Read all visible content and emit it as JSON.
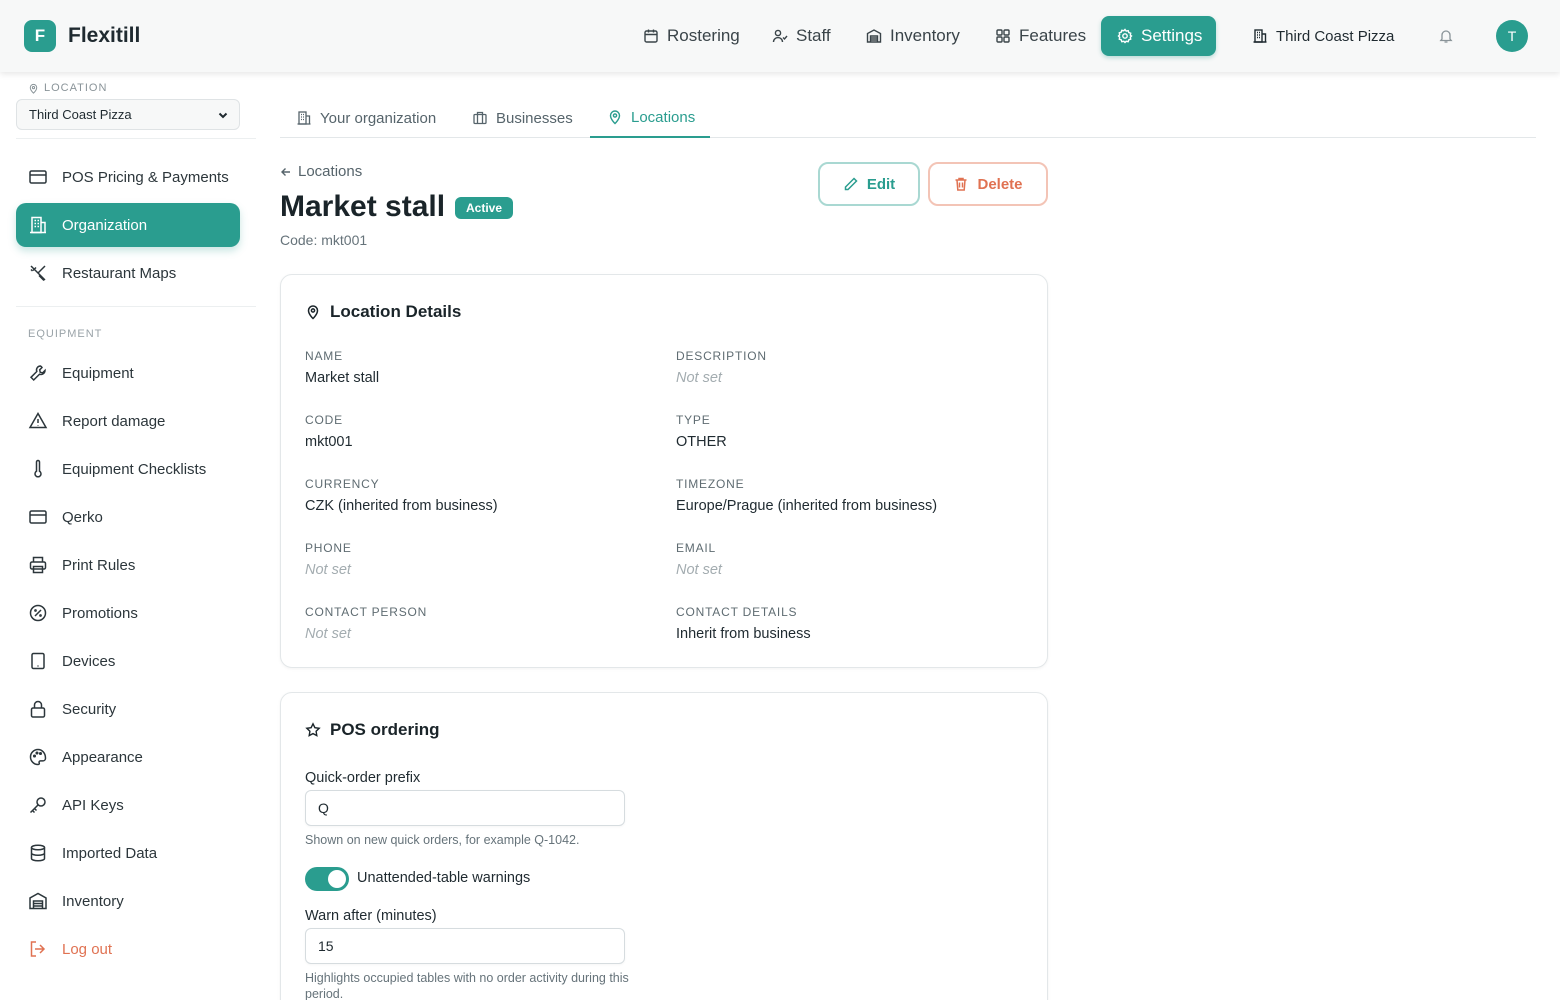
{
  "app": {
    "logo_letter": "F",
    "name": "Flexitill"
  },
  "topnav": {
    "items": [
      {
        "label": "Rostering",
        "icon": "calendar-icon"
      },
      {
        "label": "Staff",
        "icon": "user-icon"
      },
      {
        "label": "Inventory",
        "icon": "warehouse-icon"
      },
      {
        "label": "Features",
        "icon": "grid-icon"
      },
      {
        "label": "Settings",
        "icon": "gear-icon",
        "active": true
      }
    ],
    "org": "Third Coast Pizza",
    "avatar_letter": "T"
  },
  "sidebar": {
    "location_label": "LOCATION",
    "location_value": "Third Coast Pizza",
    "items": [
      {
        "label": "POS Pricing & Payments",
        "icon": "credit-card-icon"
      },
      {
        "label": "Organization",
        "icon": "building-icon",
        "active": true
      },
      {
        "label": "Restaurant Maps",
        "icon": "utensils-icon"
      }
    ],
    "equipment_section": "EQUIPMENT",
    "equipment_items": [
      {
        "label": "Equipment",
        "icon": "wrench-icon"
      },
      {
        "label": "Report damage",
        "icon": "warning-icon"
      },
      {
        "label": "Equipment Checklists",
        "icon": "thermometer-icon"
      },
      {
        "label": "Qerko",
        "icon": "credit-card-icon"
      },
      {
        "label": "Print Rules",
        "icon": "printer-icon"
      },
      {
        "label": "Promotions",
        "icon": "percent-badge-icon"
      },
      {
        "label": "Devices",
        "icon": "tablet-icon"
      },
      {
        "label": "Security",
        "icon": "lock-icon"
      },
      {
        "label": "Appearance",
        "icon": "palette-icon"
      },
      {
        "label": "API Keys",
        "icon": "key-icon"
      },
      {
        "label": "Imported Data",
        "icon": "database-icon"
      },
      {
        "label": "Inventory",
        "icon": "warehouse-icon"
      }
    ],
    "logout": "Log out"
  },
  "tabs": [
    {
      "label": "Your organization",
      "icon": "building-icon"
    },
    {
      "label": "Businesses",
      "icon": "briefcase-icon"
    },
    {
      "label": "Locations",
      "icon": "map-pin-icon",
      "active": true
    }
  ],
  "header": {
    "back_label": "Locations",
    "title": "Market stall",
    "status": "Active",
    "code_line": "Code: mkt001",
    "edit_label": "Edit",
    "delete_label": "Delete"
  },
  "location_details": {
    "title": "Location Details",
    "fields": [
      {
        "label": "NAME",
        "value": "Market stall",
        "empty": false
      },
      {
        "label": "DESCRIPTION",
        "value": "Not set",
        "empty": true
      },
      {
        "label": "CODE",
        "value": "mkt001",
        "empty": false
      },
      {
        "label": "TYPE",
        "value": "OTHER",
        "empty": false
      },
      {
        "label": "CURRENCY",
        "value": "CZK (inherited from business)",
        "empty": false
      },
      {
        "label": "TIMEZONE",
        "value": "Europe/Prague (inherited from business)",
        "empty": false
      },
      {
        "label": "PHONE",
        "value": "Not set",
        "empty": true
      },
      {
        "label": "EMAIL",
        "value": "Not set",
        "empty": true
      },
      {
        "label": "CONTACT PERSON",
        "value": "Not set",
        "empty": true
      },
      {
        "label": "CONTACT DETAILS",
        "value": "Inherit from business",
        "empty": false
      }
    ]
  },
  "pos_ordering": {
    "title": "POS ordering",
    "prefix_label": "Quick-order prefix",
    "prefix_value": "Q",
    "prefix_help": "Shown on new quick orders, for example Q-1042.",
    "toggle_label": "Unattended-table warnings",
    "toggle_on": true,
    "warn_label": "Warn after (minutes)",
    "warn_value": "15",
    "warn_help": "Highlights occupied tables with no order activity during this period."
  },
  "colors": {
    "accent": "#2a9d8f",
    "danger": "#e07252",
    "muted": "#a3acb0"
  }
}
